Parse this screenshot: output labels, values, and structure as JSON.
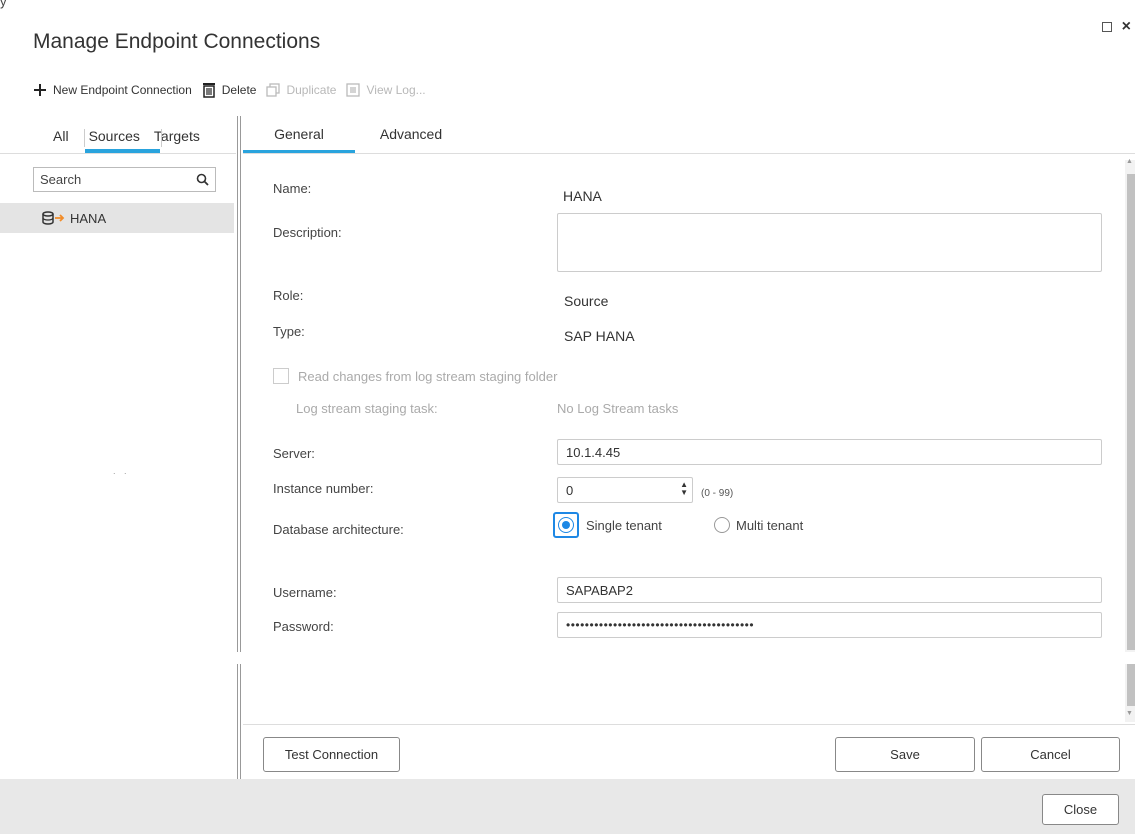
{
  "window": {
    "title": "Manage Endpoint Connections",
    "top_fragment": "y"
  },
  "toolbar": {
    "new_label": "New Endpoint Connection",
    "delete_label": "Delete",
    "duplicate_label": "Duplicate",
    "viewlog_label": "View Log..."
  },
  "left": {
    "tabs": [
      {
        "label": "All"
      },
      {
        "label": "Sources"
      },
      {
        "label": "Targets"
      }
    ],
    "active_tab": "Sources",
    "search_placeholder": "Search",
    "items": [
      {
        "label": "HANA"
      }
    ],
    "collapse_dots": ". ."
  },
  "right": {
    "tabs": [
      {
        "label": "General"
      },
      {
        "label": "Advanced"
      }
    ],
    "active_tab": "General"
  },
  "form": {
    "name_label": "Name:",
    "name_value": "HANA",
    "description_label": "Description:",
    "description_value": "",
    "role_label": "Role:",
    "role_value": "Source",
    "type_label": "Type:",
    "type_value": "SAP HANA",
    "logstream_checkbox_label": "Read changes from log stream staging folder",
    "logstream_checked": false,
    "logstream_task_label": "Log stream staging task:",
    "logstream_task_value": "No Log Stream tasks",
    "server_label": "Server:",
    "server_value": "10.1.4.45",
    "instance_label": "Instance number:",
    "instance_value": "0",
    "instance_range": "(0 - 99)",
    "dbarch_label": "Database architecture:",
    "dbarch_options": [
      {
        "label": "Single tenant",
        "selected": true
      },
      {
        "label": "Multi tenant",
        "selected": false
      }
    ],
    "username_label": "Username:",
    "username_value": "SAPABAP2",
    "password_label": "Password:",
    "password_value": "••••••••••••••••••••••••••••••••••••••••"
  },
  "buttons": {
    "test_connection": "Test Connection",
    "save": "Save",
    "cancel": "Cancel",
    "close": "Close"
  },
  "colors": {
    "accent": "#29a3dd",
    "radio": "#1e88e5",
    "endpoint_arrow": "#f28c28"
  }
}
